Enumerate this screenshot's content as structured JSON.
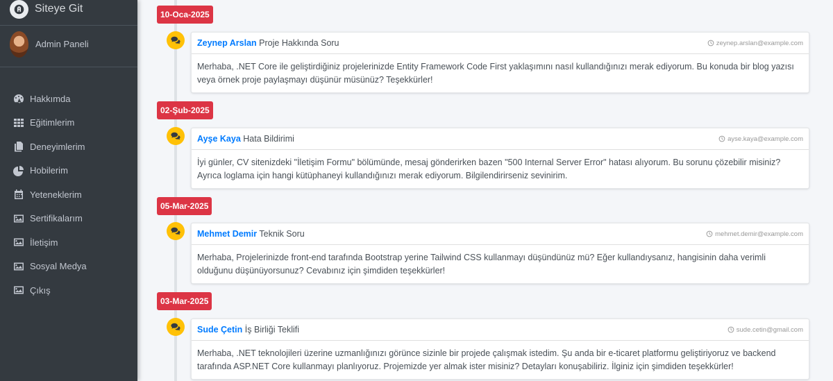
{
  "brand": {
    "title": "Siteye Git"
  },
  "user": {
    "name": "Admin Paneli"
  },
  "sidebar": {
    "items": [
      {
        "label": "Hakkımda",
        "icon": "tachometer-icon"
      },
      {
        "label": "Eğitimlerim",
        "icon": "grid-icon"
      },
      {
        "label": "Deneyimlerim",
        "icon": "files-icon"
      },
      {
        "label": "Hobilerim",
        "icon": "pie-chart-icon"
      },
      {
        "label": "Yeteneklerim",
        "icon": "calendar-icon"
      },
      {
        "label": "Sertifikalarım",
        "icon": "image-icon"
      },
      {
        "label": "İletişim",
        "icon": "image-icon"
      },
      {
        "label": "Sosyal Medya",
        "icon": "image-icon"
      },
      {
        "label": "Çıkış",
        "icon": "image-icon"
      }
    ]
  },
  "messages": [
    {
      "date": "10-Oca-2025",
      "sender": "Zeynep Arslan",
      "subject": "Proje Hakkında Soru",
      "email": "zeynep.arslan@example.com",
      "body": "Merhaba, .NET Core ile geliştirdiğiniz projelerinizde Entity Framework Code First yaklaşımını nasıl kullandığınızı merak ediyorum. Bu konuda bir blog yazısı veya örnek proje paylaşmayı düşünür müsünüz? Teşekkürler!"
    },
    {
      "date": "02-Şub-2025",
      "sender": "Ayşe Kaya",
      "subject": "Hata Bildirimi",
      "email": "ayse.kaya@example.com",
      "body": "İyi günler, CV sitenizdeki \"İletişim Formu\" bölümünde, mesaj gönderirken bazen \"500 Internal Server Error\" hatası alıyorum. Bu sorunu çözebilir misiniz? Ayrıca loglama için hangi kütüphaneyi kullandığınızı merak ediyorum. Bilgilendirirseniz sevinirim."
    },
    {
      "date": "05-Mar-2025",
      "sender": "Mehmet Demir",
      "subject": "Teknik Soru",
      "email": "mehmet.demir@example.com",
      "body": "Merhaba, Projelerinizde front-end tarafında Bootstrap yerine Tailwind CSS kullanmayı düşündünüz mü? Eğer kullandıysanız, hangisinin daha verimli olduğunu düşünüyorsunuz? Cevabınız için şimdiden teşekkürler!"
    },
    {
      "date": "03-Mar-2025",
      "sender": "Sude Çetin",
      "subject": "İş Birliği Teklifi",
      "email": "sude.cetin@gmail.com",
      "body": "Merhaba, .NET teknolojileri üzerine uzmanlığınızı görünce sizinle bir projede çalışmak istedim. Şu anda bir e-ticaret platformu geliştiriyoruz ve backend tarafında ASP.NET Core kullanmayı planlıyoruz. Projemizde yer almak ister misiniz? Detayları konuşabiliriz. İlginiz için şimdiden teşekkürler!"
    }
  ],
  "colors": {
    "sidebar_bg": "#343a40",
    "date_label": "#dc3545",
    "icon_bg": "#ffc107",
    "sender_link": "#007bff"
  }
}
